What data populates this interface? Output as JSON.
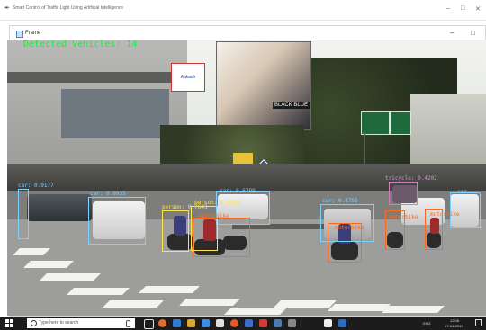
{
  "app": {
    "window_title": "Smart Control of Traffic Light Using Artificial Intelligence",
    "frame_title": "Frame",
    "controls": {
      "minimize": "–",
      "maximize": "□",
      "close": "✕"
    }
  },
  "overlay": {
    "detected_vehicles_text": "Detected Vehicles: 14",
    "billboard_text": "BLACK BLUE",
    "shop_sign_text": "Aakash",
    "shop_sign_text_2": "Aakash",
    "colors": {
      "detect_text": "#00ff2a",
      "car": "#7fd0ff",
      "person": "#ffe34a",
      "motorbike": "#ff6a1a",
      "tricycle": "#d67ac0"
    }
  },
  "detections": [
    {
      "label": "car: 0.9177",
      "class": "car"
    },
    {
      "label": "car: 0.9935",
      "class": "car"
    },
    {
      "label": "person: 0.7643",
      "class": "person"
    },
    {
      "label": "person: 0.9389",
      "class": "person"
    },
    {
      "label": "car: 0.6799",
      "class": "car"
    },
    {
      "label": "motorbike",
      "class": "motorbike"
    },
    {
      "label": "car: 0.8756",
      "class": "car"
    },
    {
      "label": "motorbike",
      "class": "motorbike"
    },
    {
      "label": "tricycle: 0.4202",
      "class": "tricycle"
    },
    {
      "label": "motorbike",
      "class": "motorbike"
    },
    {
      "label": "car",
      "class": "car"
    },
    {
      "label": "motorbike",
      "class": "motorbike"
    }
  ],
  "taskbar": {
    "search_placeholder": "Type here to search",
    "tray_language": "ENG",
    "tray_time": "12:08",
    "tray_date": "17-04-2019",
    "icons": [
      "start-icon",
      "search-icon",
      "task-view-icon",
      "edge-icon",
      "explorer-icon",
      "store-icon",
      "chrome-icon",
      "firefox-icon",
      "word-icon",
      "pdf-icon",
      "python-icon",
      "settings-icon",
      "network-icon",
      "volume-icon",
      "notification-icon"
    ]
  }
}
